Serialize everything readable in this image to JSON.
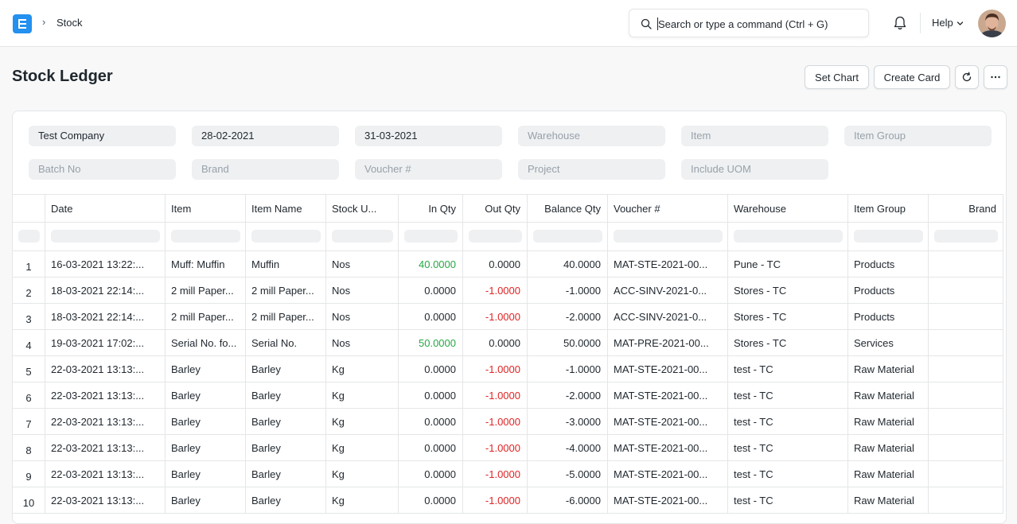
{
  "breadcrumb": {
    "label": "Stock"
  },
  "search": {
    "placeholder": "Search or type a command (Ctrl + G)"
  },
  "help": {
    "label": "Help"
  },
  "page": {
    "title": "Stock Ledger"
  },
  "actions": {
    "set_chart": "Set Chart",
    "create_card": "Create Card"
  },
  "filters": {
    "company": "Test Company",
    "from_date": "28-02-2021",
    "to_date": "31-03-2021",
    "warehouse": "Warehouse",
    "item": "Item",
    "item_group": "Item Group",
    "batch_no": "Batch No",
    "brand": "Brand",
    "voucher_no": "Voucher #",
    "project": "Project",
    "include_uom": "Include UOM"
  },
  "columns": [
    "Date",
    "Item",
    "Item Name",
    "Stock U...",
    "In Qty",
    "Out Qty",
    "Balance Qty",
    "Voucher #",
    "Warehouse",
    "Item Group",
    "Brand"
  ],
  "rows": [
    {
      "n": "1",
      "date": "16-03-2021 13:22:...",
      "item": "Muff: Muffin",
      "item_name": "Muffin",
      "uom": "Nos",
      "in_qty": "40.0000",
      "out_qty": "0.0000",
      "balance": "40.0000",
      "voucher": "MAT-STE-2021-00...",
      "warehouse": "Pune - TC",
      "item_group": "Products",
      "brand": ""
    },
    {
      "n": "2",
      "date": "18-03-2021 22:14:...",
      "item": "2 mill Paper...",
      "item_name": "2 mill Paper...",
      "uom": "Nos",
      "in_qty": "0.0000",
      "out_qty": "-1.0000",
      "balance": "-1.0000",
      "voucher": "ACC-SINV-2021-0...",
      "warehouse": "Stores - TC",
      "item_group": "Products",
      "brand": ""
    },
    {
      "n": "3",
      "date": "18-03-2021 22:14:...",
      "item": "2 mill Paper...",
      "item_name": "2 mill Paper...",
      "uom": "Nos",
      "in_qty": "0.0000",
      "out_qty": "-1.0000",
      "balance": "-2.0000",
      "voucher": "ACC-SINV-2021-0...",
      "warehouse": "Stores - TC",
      "item_group": "Products",
      "brand": ""
    },
    {
      "n": "4",
      "date": "19-03-2021 17:02:...",
      "item": "Serial No. fo...",
      "item_name": "Serial No.",
      "uom": "Nos",
      "in_qty": "50.0000",
      "out_qty": "0.0000",
      "balance": "50.0000",
      "voucher": "MAT-PRE-2021-00...",
      "warehouse": "Stores - TC",
      "item_group": "Services",
      "brand": ""
    },
    {
      "n": "5",
      "date": "22-03-2021 13:13:...",
      "item": "Barley",
      "item_name": "Barley",
      "uom": "Kg",
      "in_qty": "0.0000",
      "out_qty": "-1.0000",
      "balance": "-1.0000",
      "voucher": "MAT-STE-2021-00...",
      "warehouse": "test - TC",
      "item_group": "Raw Material",
      "brand": ""
    },
    {
      "n": "6",
      "date": "22-03-2021 13:13:...",
      "item": "Barley",
      "item_name": "Barley",
      "uom": "Kg",
      "in_qty": "0.0000",
      "out_qty": "-1.0000",
      "balance": "-2.0000",
      "voucher": "MAT-STE-2021-00...",
      "warehouse": "test - TC",
      "item_group": "Raw Material",
      "brand": ""
    },
    {
      "n": "7",
      "date": "22-03-2021 13:13:...",
      "item": "Barley",
      "item_name": "Barley",
      "uom": "Kg",
      "in_qty": "0.0000",
      "out_qty": "-1.0000",
      "balance": "-3.0000",
      "voucher": "MAT-STE-2021-00...",
      "warehouse": "test - TC",
      "item_group": "Raw Material",
      "brand": ""
    },
    {
      "n": "8",
      "date": "22-03-2021 13:13:...",
      "item": "Barley",
      "item_name": "Barley",
      "uom": "Kg",
      "in_qty": "0.0000",
      "out_qty": "-1.0000",
      "balance": "-4.0000",
      "voucher": "MAT-STE-2021-00...",
      "warehouse": "test - TC",
      "item_group": "Raw Material",
      "brand": ""
    },
    {
      "n": "9",
      "date": "22-03-2021 13:13:...",
      "item": "Barley",
      "item_name": "Barley",
      "uom": "Kg",
      "in_qty": "0.0000",
      "out_qty": "-1.0000",
      "balance": "-5.0000",
      "voucher": "MAT-STE-2021-00...",
      "warehouse": "test - TC",
      "item_group": "Raw Material",
      "brand": ""
    },
    {
      "n": "10",
      "date": "22-03-2021 13:13:...",
      "item": "Barley",
      "item_name": "Barley",
      "uom": "Kg",
      "in_qty": "0.0000",
      "out_qty": "-1.0000",
      "balance": "-6.0000",
      "voucher": "MAT-STE-2021-00...",
      "warehouse": "test - TC",
      "item_group": "Raw Material",
      "brand": ""
    }
  ],
  "colors": {
    "accent": "#2490ef",
    "positive": "#28a745",
    "negative": "#e02424"
  }
}
